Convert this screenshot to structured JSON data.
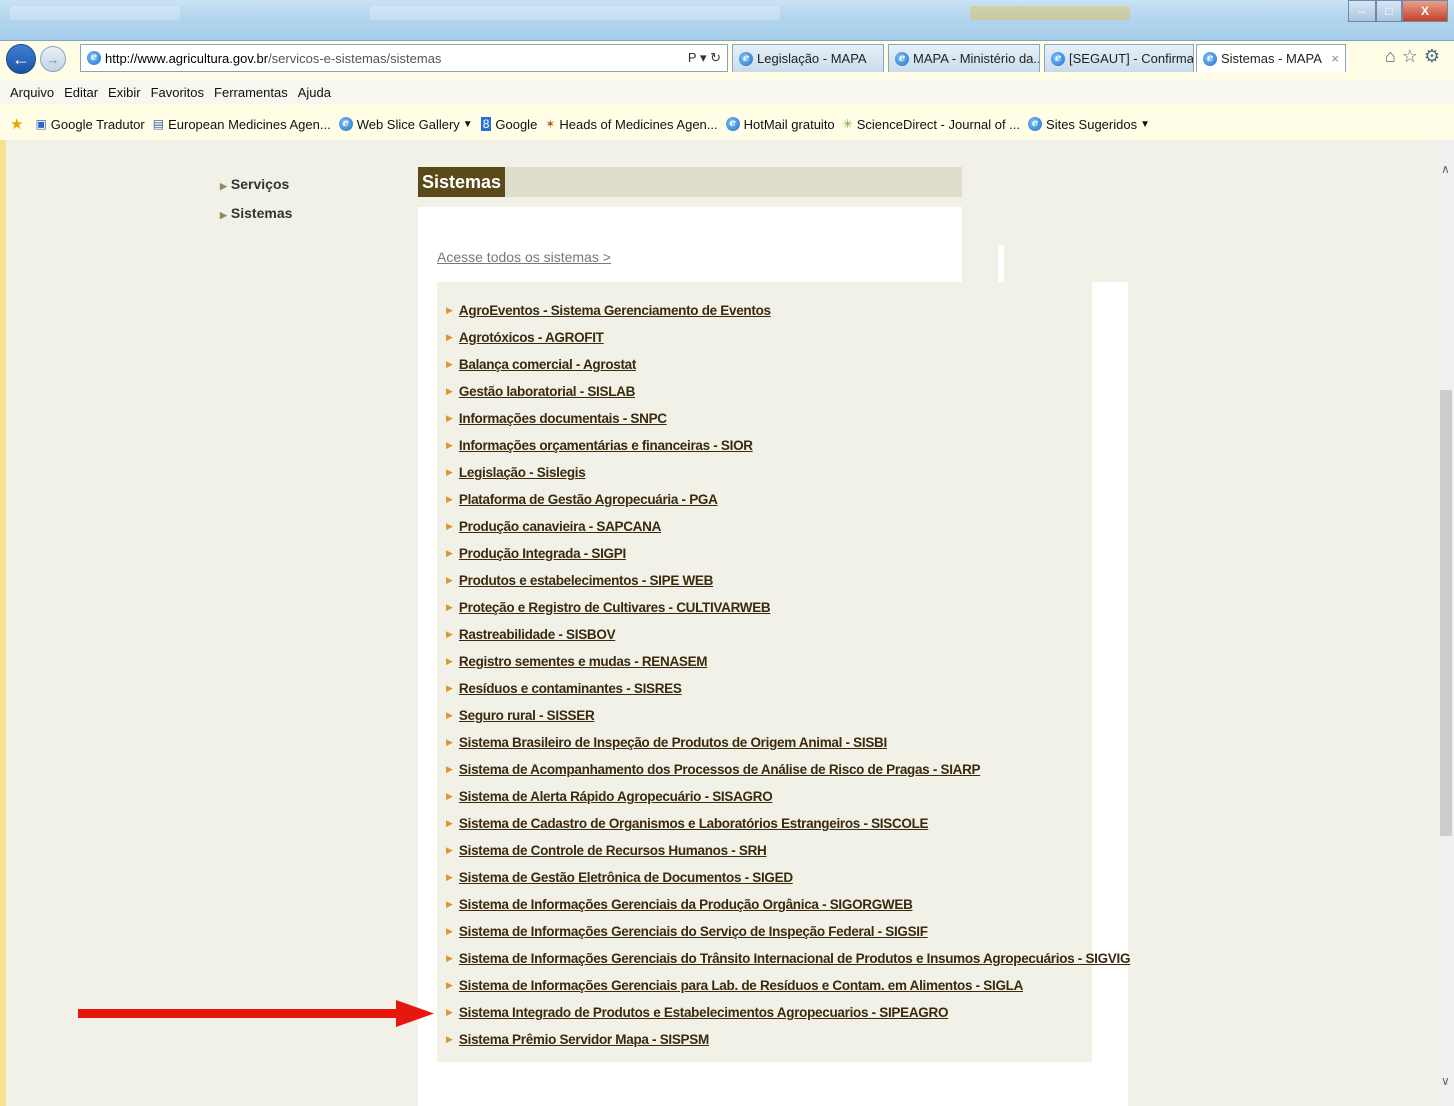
{
  "browser": {
    "address_url_domain": "http://www.agricultura.gov.br",
    "address_url_path": "/servicos-e-sistemas/sistemas",
    "address_tools": "Ρ ▾ ↻",
    "tabs": [
      {
        "label": "Legislação - MAPA"
      },
      {
        "label": "MAPA - Ministério da..."
      },
      {
        "label": "[SEGAUT] - Confirma..."
      },
      {
        "label": "Sistemas - MAPA"
      }
    ],
    "tab_close": "×",
    "window_controls": {
      "minimize": "–",
      "maximize": "□",
      "close": "X"
    },
    "tool_icons": "⌂☆⚙"
  },
  "menu": [
    "Arquivo",
    "Editar",
    "Exibir",
    "Favoritos",
    "Ferramentas",
    "Ajuda"
  ],
  "favorites": [
    {
      "label": "Google Tradutor",
      "icon": "translate-icon"
    },
    {
      "label": "European Medicines Agen...",
      "icon": "ema-icon"
    },
    {
      "label": "Web Slice Gallery",
      "icon": "ie-icon",
      "dropdown": true
    },
    {
      "label": "Google",
      "icon": "google-icon"
    },
    {
      "label": "Heads of Medicines Agen...",
      "icon": "hma-icon"
    },
    {
      "label": "HotMail gratuito",
      "icon": "ie-icon"
    },
    {
      "label": "ScienceDirect - Journal of ...",
      "icon": "sciencedirect-icon"
    },
    {
      "label": "Sites Sugeridos",
      "icon": "ie-icon",
      "dropdown": true
    }
  ],
  "sidebar": {
    "items": [
      "Serviços",
      "Sistemas"
    ]
  },
  "main": {
    "section_title": "Sistemas",
    "access_all": "Acesse todos os sistemas >",
    "systems": [
      "AgroEventos - Sistema Gerenciamento de Eventos",
      "Agrotóxicos - AGROFIT",
      "Balança comercial - Agrostat",
      "Gestão laboratorial - SISLAB",
      "Informações documentais - SNPC",
      "Informações orçamentárias e financeiras - SIOR",
      "Legislação - Sislegis",
      "Plataforma de Gestão Agropecuária - PGA",
      "Produção canavieira - SAPCANA",
      "Produção Integrada - SIGPI",
      "Produtos e estabelecimentos - SIPE WEB",
      "Proteção e Registro de Cultivares - CULTIVARWEB",
      "Rastreabilidade - SISBOV",
      "Registro sementes e mudas - RENASEM",
      "Resíduos e contaminantes - SISRES",
      "Seguro rural - SISSER",
      "Sistema Brasileiro de Inspeção de Produtos de Origem Animal - SISBI",
      "Sistema de Acompanhamento dos Processos de Análise de Risco de Pragas - SIARP",
      "Sistema de Alerta Rápido Agropecuário - SISAGRO",
      "Sistema de Cadastro de Organismos e Laboratórios Estrangeiros - SISCOLE",
      "Sistema de Controle de Recursos Humanos - SRH",
      "Sistema de Gestão Eletrônica de Documentos - SIGED",
      "Sistema de Informações Gerenciais da Produção Orgânica - SIGORGWEB",
      "Sistema de Informações Gerenciais do Serviço de Inspeção Federal - SIGSIF",
      "Sistema de Informações Gerenciais do Trânsito Internacional de Produtos e Insumos Agropecuários - SIGVIG",
      "Sistema de Informações Gerenciais para Lab. de Resíduos e Contam. em Alimentos - SIGLA",
      "Sistema Integrado de Produtos e Estabelecimentos Agropecuarios - SIPEAGRO",
      "Sistema Prêmio Servidor Mapa - SISPSM"
    ],
    "highlighted_system_index": 26
  },
  "colors": {
    "link_text": "#3a2a0e",
    "section_title_bg": "#5a4a1a",
    "bullet": "#d89a2c",
    "annotation_arrow": "#e8170e"
  }
}
